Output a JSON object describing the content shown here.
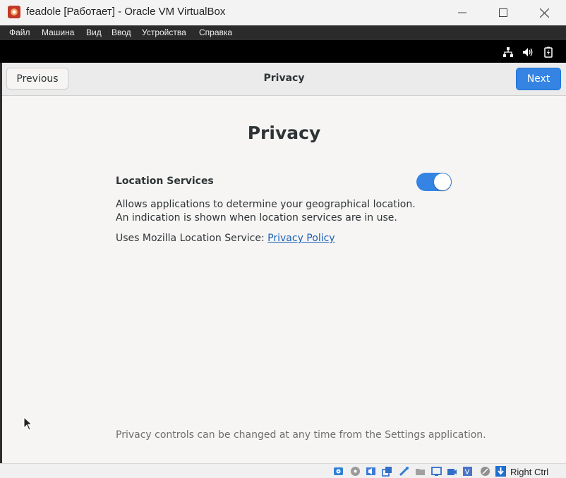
{
  "window": {
    "title": "feadole [Работает] - Oracle VM VirtualBox",
    "minimize_glyph": "—",
    "maximize_glyph": "☐",
    "close_glyph": "✕"
  },
  "menu": [
    "Файл",
    "Машина",
    "Вид",
    "Ввод",
    "Устройства",
    "Справка"
  ],
  "header": {
    "previous_label": "Previous",
    "title": "Privacy",
    "next_label": "Next"
  },
  "page": {
    "title": "Privacy",
    "location_services_label": "Location Services",
    "location_services_enabled": true,
    "description": "Allows applications to determine your geographical location. An indication is shown when location services are in use.",
    "mls_prefix": "Uses Mozilla Location Service: ",
    "mls_link": "Privacy Policy",
    "footer_note": "Privacy controls can be changed at any time from the Settings application."
  },
  "statusbar": {
    "host_key": "Right Ctrl",
    "icons": [
      "hard-disk-icon",
      "optical-disk-icon",
      "audio-icon",
      "network-icon",
      "usb-icon",
      "shared-folders-icon",
      "display-icon",
      "recording-icon",
      "cpu-icon",
      "mouse-integration-icon",
      "keyboard-capture-icon"
    ]
  },
  "colors": {
    "accent": "#3584e4",
    "link": "#1a5fb4",
    "menubar": "#2b2b2b"
  }
}
